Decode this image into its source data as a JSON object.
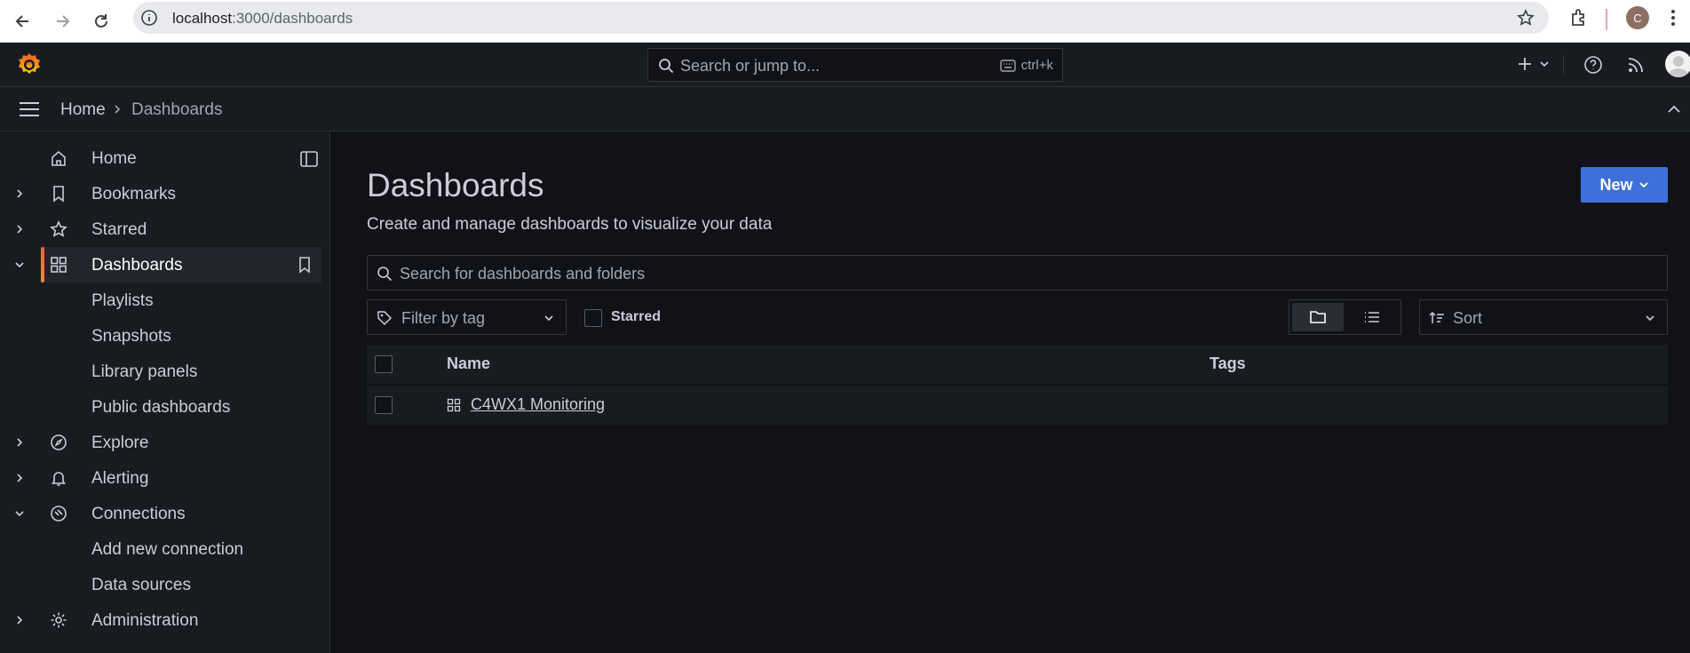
{
  "browser": {
    "url_host": "localhost",
    "url_path": ":3000/dashboards",
    "profile_initial": "C"
  },
  "topbar": {
    "search_placeholder": "Search or jump to...",
    "search_shortcut": "ctrl+k"
  },
  "breadcrumb": {
    "home": "Home",
    "current": "Dashboards"
  },
  "sidebar": {
    "items": [
      {
        "label": "Home",
        "icon": "home-icon"
      },
      {
        "label": "Bookmarks",
        "icon": "bookmark-icon"
      },
      {
        "label": "Starred",
        "icon": "star-icon"
      },
      {
        "label": "Dashboards",
        "icon": "apps-icon",
        "active": true
      },
      {
        "label": "Playlists"
      },
      {
        "label": "Snapshots"
      },
      {
        "label": "Library panels"
      },
      {
        "label": "Public dashboards"
      },
      {
        "label": "Explore",
        "icon": "compass-icon"
      },
      {
        "label": "Alerting",
        "icon": "bell-icon"
      },
      {
        "label": "Connections",
        "icon": "connections-icon"
      },
      {
        "label": "Add new connection"
      },
      {
        "label": "Data sources"
      },
      {
        "label": "Administration",
        "icon": "cog-icon"
      }
    ]
  },
  "main": {
    "title": "Dashboards",
    "subtitle": "Create and manage dashboards to visualize your data",
    "new_label": "New",
    "search_placeholder": "Search for dashboards and folders",
    "tag_filter_placeholder": "Filter by tag",
    "starred_label": "Starred",
    "sort_placeholder": "Sort",
    "columns": {
      "name": "Name",
      "tags": "Tags"
    },
    "rows": [
      {
        "name": "C4WX1 Monitoring",
        "tags": ""
      }
    ]
  },
  "colors": {
    "accent": "#3d71d9",
    "active_bar": "#f55f3e",
    "background": "#111217",
    "panel": "#181b1f"
  }
}
